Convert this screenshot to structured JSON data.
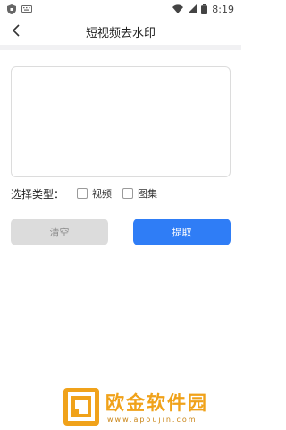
{
  "status_bar": {
    "time": "8:19",
    "left_icons": [
      "shield-icon",
      "keyboard-icon"
    ],
    "right_icons": [
      "wifi-icon",
      "signal-icon",
      "battery-icon"
    ]
  },
  "app_bar": {
    "back_icon": "chevron-left-icon",
    "title": "短视频去水印"
  },
  "input": {
    "value": "",
    "placeholder": ""
  },
  "type_select": {
    "label": "选择类型：",
    "options": [
      {
        "label": "视频",
        "checked": false
      },
      {
        "label": "图集",
        "checked": false
      }
    ]
  },
  "buttons": {
    "clear_label": "清空",
    "extract_label": "提取"
  },
  "colors": {
    "accent": "#2f7df6",
    "clear_bg": "#dcdcdc",
    "watermark": "#f0a21a"
  },
  "watermark": {
    "text": "欧金软件园",
    "url": "www.apoujin.com"
  }
}
